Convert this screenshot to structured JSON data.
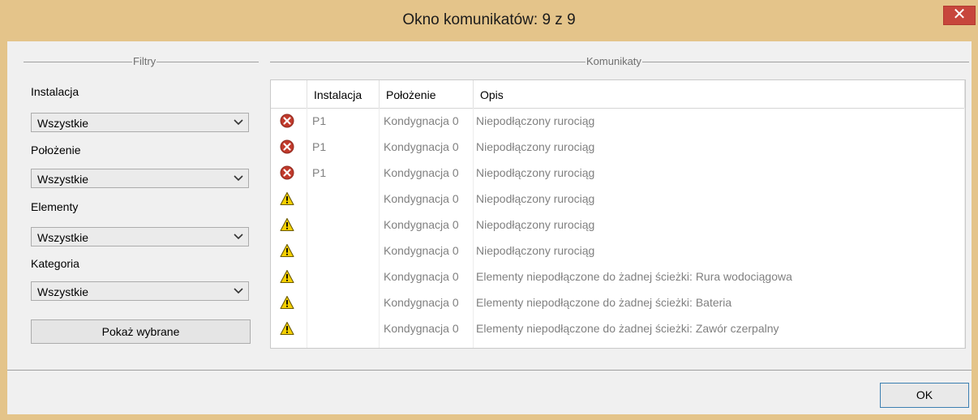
{
  "window": {
    "title": "Okno komunikatów: 9 z 9",
    "close_glyph": "✕"
  },
  "filters": {
    "group_title": "Filtry",
    "fields": [
      {
        "label": "Instalacja",
        "value": "Wszystkie"
      },
      {
        "label": "Położenie",
        "value": "Wszystkie"
      },
      {
        "label": "Elementy",
        "value": "Wszystkie"
      },
      {
        "label": "Kategoria",
        "value": "Wszystkie"
      }
    ],
    "show_button": "Pokaż wybrane"
  },
  "messages": {
    "group_title": "Komunikaty",
    "columns": [
      "Instalacja",
      "Położenie",
      "Opis"
    ],
    "rows": [
      {
        "icon": "error-icon",
        "instalacja": "P1",
        "polozenie": "Kondygnacja 0",
        "opis": "Niepodłączony rurociąg"
      },
      {
        "icon": "error-icon",
        "instalacja": "P1",
        "polozenie": "Kondygnacja 0",
        "opis": "Niepodłączony rurociąg"
      },
      {
        "icon": "error-icon",
        "instalacja": "P1",
        "polozenie": "Kondygnacja 0",
        "opis": "Niepodłączony rurociąg"
      },
      {
        "icon": "warning-icon",
        "instalacja": "",
        "polozenie": "Kondygnacja 0",
        "opis": "Niepodłączony rurociąg"
      },
      {
        "icon": "warning-icon",
        "instalacja": "",
        "polozenie": "Kondygnacja 0",
        "opis": "Niepodłączony rurociąg"
      },
      {
        "icon": "warning-icon",
        "instalacja": "",
        "polozenie": "Kondygnacja 0",
        "opis": "Niepodłączony rurociąg"
      },
      {
        "icon": "warning-icon",
        "instalacja": "",
        "polozenie": "Kondygnacja 0",
        "opis": "Elementy niepodłączone do żadnej ścieżki: Rura wodociągowa"
      },
      {
        "icon": "warning-icon",
        "instalacja": "",
        "polozenie": "Kondygnacja 0",
        "opis": "Elementy niepodłączone do żadnej ścieżki: Bateria"
      },
      {
        "icon": "warning-icon",
        "instalacja": "",
        "polozenie": "Kondygnacja 0",
        "opis": "Elementy niepodłączone do żadnej ścieżki: Zawór czerpalny"
      }
    ]
  },
  "ok_button": "OK",
  "colors": {
    "frame": "#e4c48a",
    "close": "#c7463c",
    "error": "#c0392b",
    "warning": "#f5d000"
  }
}
